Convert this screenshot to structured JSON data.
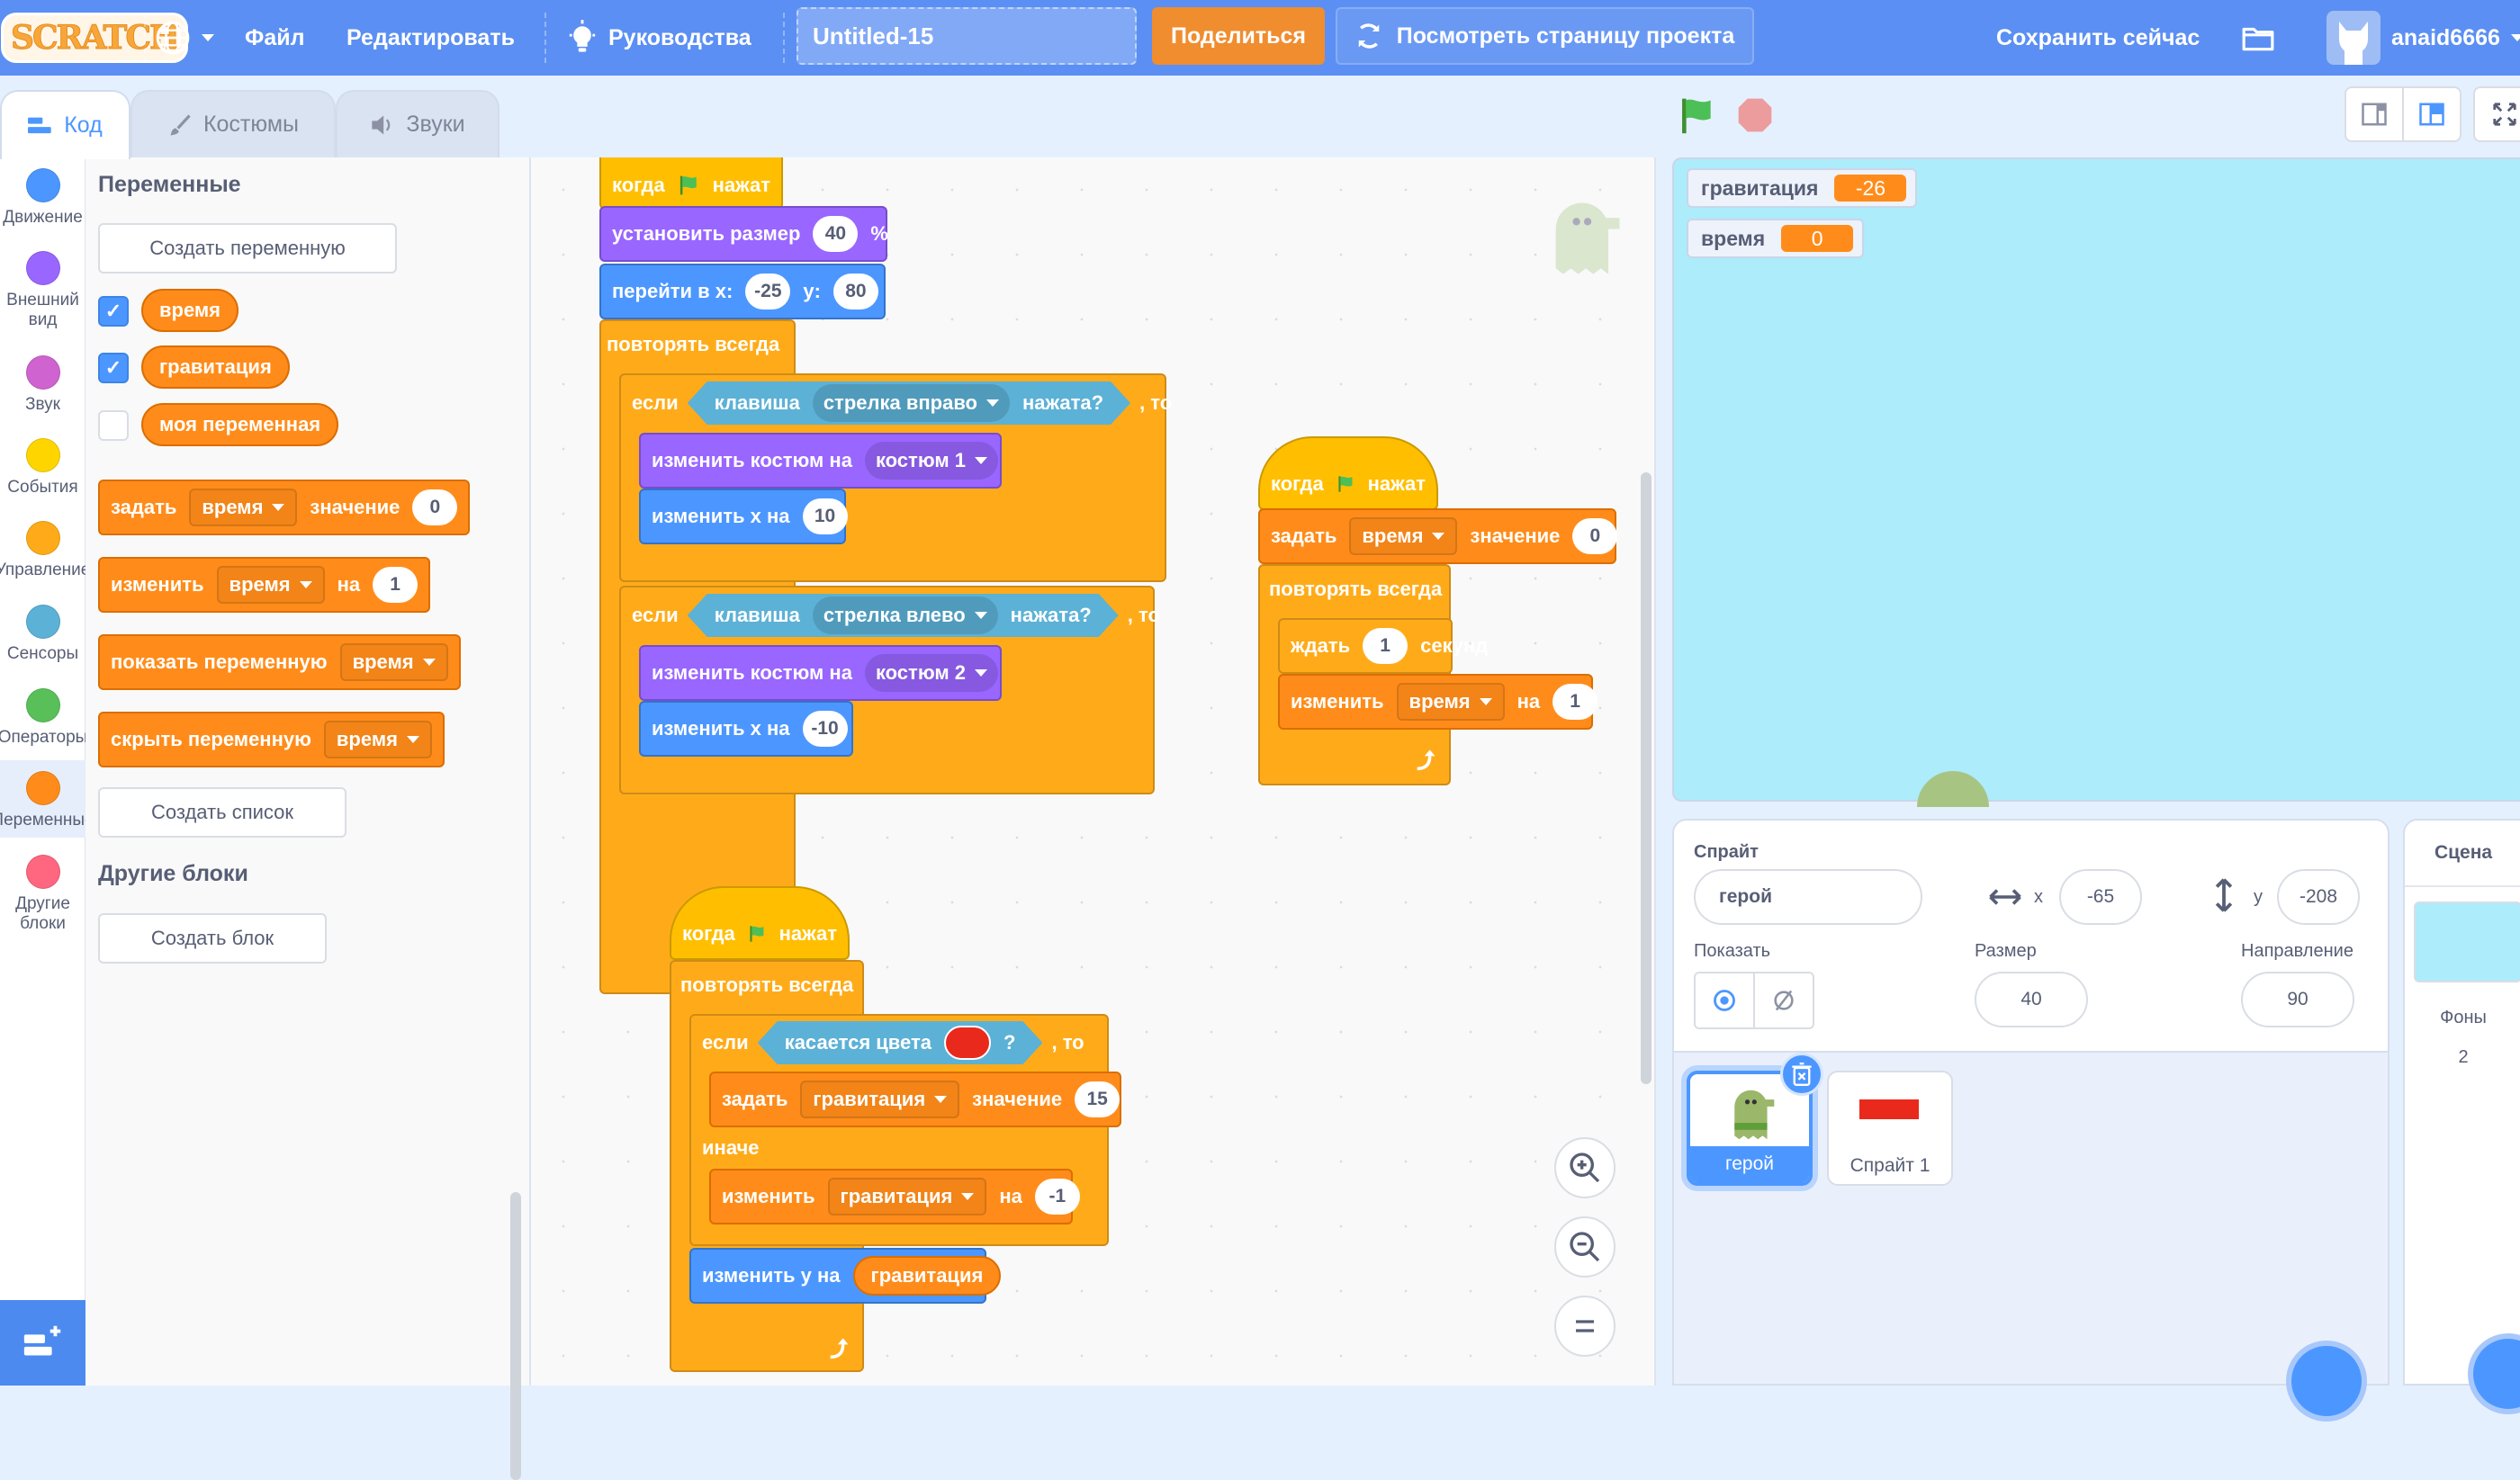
{
  "header": {
    "logo": "SCRATCH",
    "language_icon": "globe-icon",
    "menu": [
      "Файл",
      "Редактировать"
    ],
    "tutorials": "Руководства",
    "project_title": "Untitled-15",
    "share": "Поделиться",
    "view_project_page": "Посмотреть страницу проекта",
    "save_now": "Сохранить сейчас",
    "username": "anaid6666"
  },
  "tabs": [
    {
      "label": "Код",
      "icon": "code-icon",
      "active": true
    },
    {
      "label": "Костюмы",
      "icon": "brush-icon",
      "active": false
    },
    {
      "label": "Звуки",
      "icon": "speaker-icon",
      "active": false
    }
  ],
  "categories": [
    {
      "label": "Движение",
      "color": "#4c97ff"
    },
    {
      "label": "Внешний вид",
      "color": "#9966ff"
    },
    {
      "label": "Звук",
      "color": "#cf63cf"
    },
    {
      "label": "События",
      "color": "#ffd500"
    },
    {
      "label": "Управление",
      "color": "#ffab19"
    },
    {
      "label": "Сенсоры",
      "color": "#5cb1d6"
    },
    {
      "label": "Операторы",
      "color": "#59c059"
    },
    {
      "label": "Переменные",
      "color": "#ff8c1a",
      "selected": true
    },
    {
      "label": "Другие блоки",
      "color": "#ff6680"
    }
  ],
  "palette": {
    "variables_heading": "Переменные",
    "create_variable": "Создать переменную",
    "variables": [
      {
        "name": "время",
        "checked": true
      },
      {
        "name": "гравитация",
        "checked": true
      },
      {
        "name": "моя переменная",
        "checked": false
      }
    ],
    "blocks": {
      "set": {
        "label": "задать",
        "var": "время",
        "to": "значение",
        "value": "0"
      },
      "change": {
        "label": "изменить",
        "var": "время",
        "by": "на",
        "value": "1"
      },
      "show": {
        "label": "показать переменную",
        "var": "время"
      },
      "hide": {
        "label": "скрыть переменную",
        "var": "время"
      }
    },
    "create_list": "Создать список",
    "my_blocks_heading": "Другие блоки",
    "create_block": "Создать блок"
  },
  "scripts": {
    "s1": {
      "hat": {
        "when": "когда",
        "clicked": "нажат"
      },
      "set_size": {
        "label": "установить размер",
        "value": "40",
        "unit": "%"
      },
      "goto": {
        "label": "перейти в x:",
        "x": "-25",
        "ylabel": "y:",
        "y": "80"
      },
      "forever": "повторять всегда",
      "if1": {
        "if": "если",
        "key": "клавиша",
        "key_opt": "стрелка вправо",
        "pressed": "нажата?",
        "then": ", то"
      },
      "costume1": {
        "label": "изменить костюм на",
        "opt": "костюм 1"
      },
      "changex1": {
        "label": "изменить x на",
        "value": "10"
      },
      "if2": {
        "if": "если",
        "key": "клавиша",
        "key_opt": "стрелка влево",
        "pressed": "нажата?",
        "then": ", то"
      },
      "costume2": {
        "label": "изменить костюм на",
        "opt": "костюм 2"
      },
      "changex2": {
        "label": "изменить x на",
        "value": "-10"
      }
    },
    "s2": {
      "hat": {
        "when": "когда",
        "clicked": "нажат"
      },
      "set": {
        "label": "задать",
        "var": "время",
        "to": "значение",
        "value": "0"
      },
      "forever": "повторять всегда",
      "wait": {
        "label": "ждать",
        "value": "1",
        "unit": "секунд"
      },
      "change": {
        "label": "изменить",
        "var": "время",
        "by": "на",
        "value": "1"
      }
    },
    "s3": {
      "hat": {
        "when": "когда",
        "clicked": "нажат"
      },
      "forever": "повторять всегда",
      "if": {
        "if": "если",
        "touching": "касается цвета",
        "q": "?",
        "then": ", то",
        "color": "#e8291c"
      },
      "set": {
        "label": "задать",
        "var": "гравитация",
        "to": "значение",
        "value": "15"
      },
      "else": "иначе",
      "change": {
        "label": "изменить",
        "var": "гравитация",
        "by": "на",
        "value": "-1"
      },
      "changey": {
        "label": "изменить у на",
        "reporter": "гравитация"
      }
    }
  },
  "stage": {
    "monitors": [
      {
        "name": "гравитация",
        "value": "-26"
      },
      {
        "name": "время",
        "value": "0"
      }
    ]
  },
  "sprite_info": {
    "sprite_label": "Спрайт",
    "sprite_name": "герой",
    "x_label": "x",
    "x": "-65",
    "y_label": "y",
    "y": "-208",
    "show_label": "Показать",
    "size_label": "Размер",
    "size": "40",
    "direction_label": "Направление",
    "direction": "90"
  },
  "sprites": [
    {
      "name": "герой",
      "selected": true
    },
    {
      "name": "Спрайт 1",
      "selected": false
    }
  ],
  "stage_pane": {
    "title": "Сцена",
    "backdrops_label": "Фоны",
    "backdrops_count": "2"
  }
}
